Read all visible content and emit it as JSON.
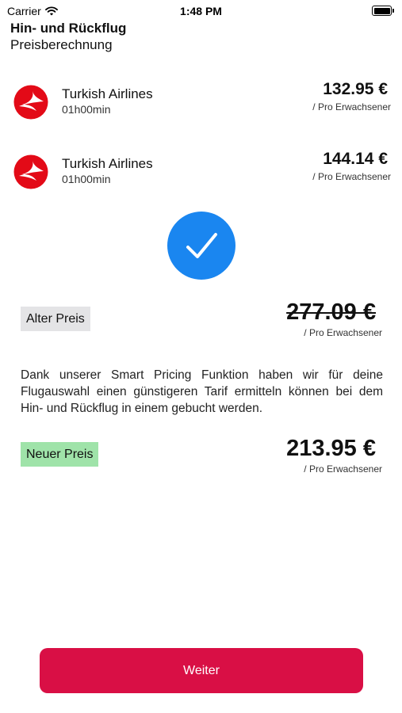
{
  "status_bar": {
    "carrier": "Carrier",
    "time": "1:48 PM"
  },
  "header": {
    "title": "Hin- und Rückflug",
    "subtitle": "Preisberechnung"
  },
  "flights": [
    {
      "airline": "Turkish Airlines",
      "duration": "01h00min",
      "price": "132.95 €",
      "per_person": "/ Pro Erwachsener"
    },
    {
      "airline": "Turkish Airlines",
      "duration": "01h00min",
      "price": "144.14 €",
      "per_person": "/ Pro Erwachsener"
    }
  ],
  "old_price": {
    "label": "Alter Preis",
    "price": "277.09 €",
    "per_person": "/ Pro Erwachsener"
  },
  "info_text": "Dank unserer Smart Pricing Funktion haben wir für deine Flugauswahl einen günstigeren Tarif ermitteln können bei dem Hin- und Rückflug in einem gebucht werden.",
  "new_price": {
    "label": "Neuer Preis",
    "price": "213.95 €",
    "per_person": "/ Pro Erwachsener"
  },
  "continue_button": {
    "label": "Weiter"
  },
  "colors": {
    "accent": "#d90f45",
    "check": "#1a86f0",
    "airline_red": "#e30a17",
    "new_badge": "#9fe3a9",
    "old_badge": "#e4e4e6"
  },
  "icons": {
    "wifi": "wifi-icon",
    "battery": "battery-icon",
    "airline_logo": "turkish-airlines-logo",
    "check": "checkmark-icon"
  }
}
